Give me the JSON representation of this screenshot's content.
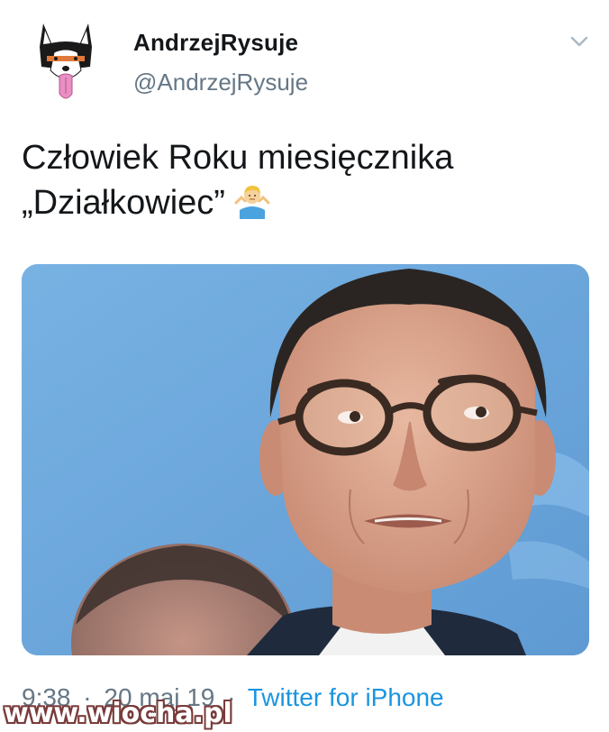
{
  "account": {
    "display_name": "AndrzejRysuje",
    "handle": "@AndrzejRysuje",
    "avatar_icon": "husky-dog-avatar-icon"
  },
  "menu": {
    "icon": "chevron-down-icon"
  },
  "tweet": {
    "line1": "Człowiek Roku miesięcznika",
    "line2": "„Działkowiec”",
    "emoji": "person-shrugging-emoji"
  },
  "media": {
    "description_icon": "photo-man-with-glasses"
  },
  "meta": {
    "time": "9:38",
    "separator1": "·",
    "date": "20 maj 19",
    "separator2": "·",
    "source": "Twitter for iPhone"
  },
  "watermark": {
    "text": "www.wiocha.pl"
  },
  "colors": {
    "text_primary": "#14171a",
    "text_secondary": "#657786",
    "link": "#1b95e0",
    "photo_background": "#6fa8dd"
  }
}
